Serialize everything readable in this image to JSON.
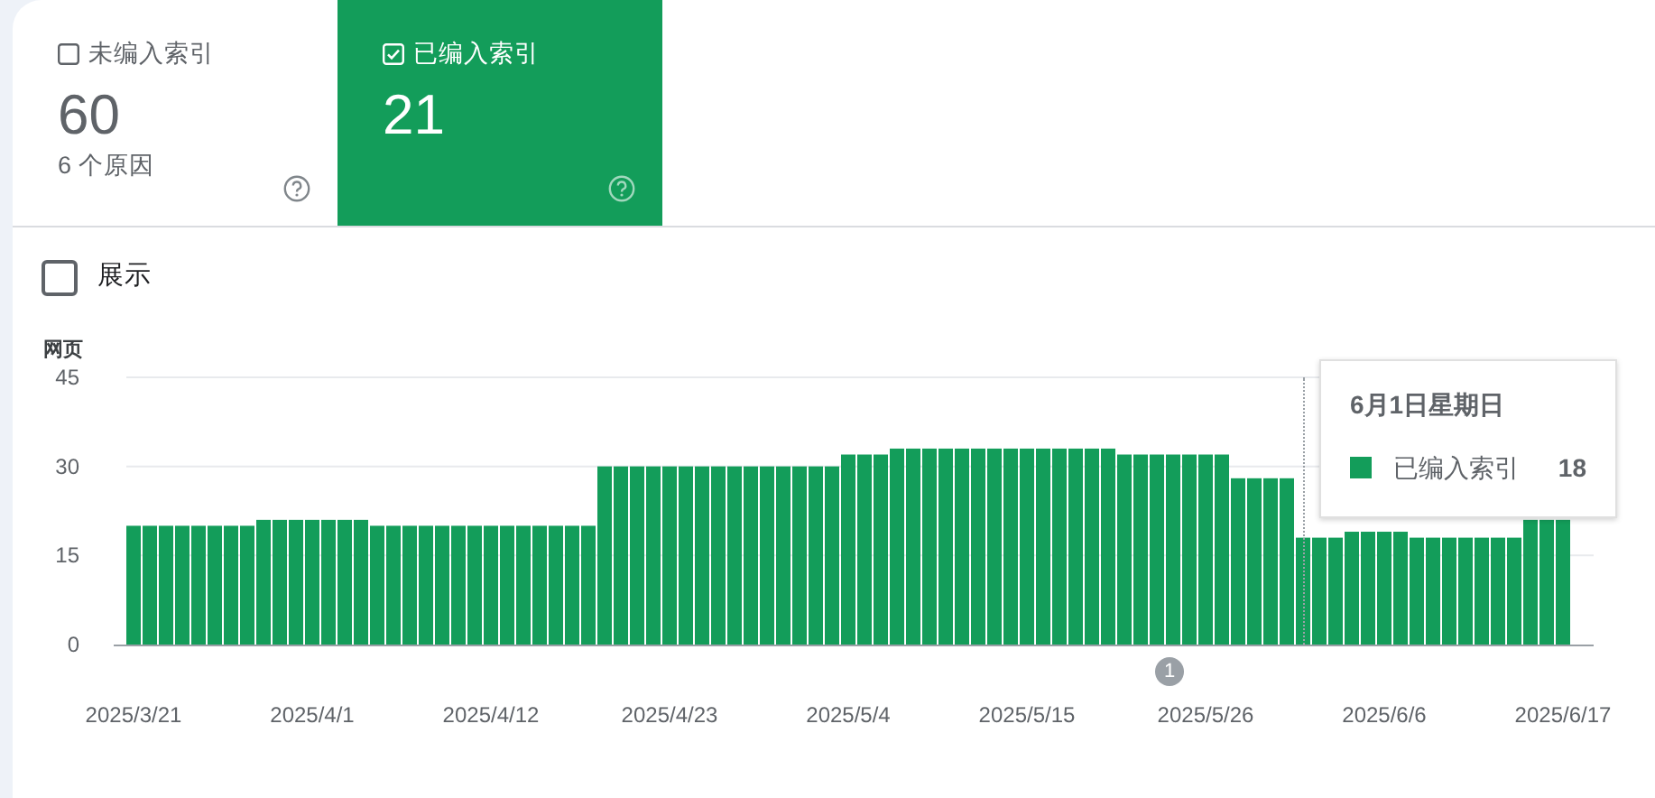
{
  "tabs": [
    {
      "label": "未编入索引",
      "count": "60",
      "subtitle": "6 个原因",
      "selected": false
    },
    {
      "label": "已编入索引",
      "count": "21",
      "selected": true
    }
  ],
  "show_toggle": {
    "label": "展示",
    "checked": false
  },
  "chart_data": {
    "type": "bar",
    "ylabel": "网页",
    "categories": [
      "2025/3/21",
      null,
      null,
      null,
      null,
      null,
      null,
      null,
      null,
      null,
      null,
      "2025/4/1",
      null,
      null,
      null,
      null,
      null,
      null,
      null,
      null,
      null,
      null,
      "2025/4/12",
      null,
      null,
      null,
      null,
      null,
      null,
      null,
      null,
      null,
      null,
      "2025/4/23",
      null,
      null,
      null,
      null,
      null,
      null,
      null,
      null,
      null,
      null,
      "2025/5/4",
      null,
      null,
      null,
      null,
      null,
      null,
      null,
      null,
      null,
      null,
      "2025/5/15",
      null,
      null,
      null,
      null,
      null,
      null,
      null,
      null,
      null,
      null,
      "2025/5/26",
      null,
      null,
      null,
      null,
      null,
      null,
      null,
      null,
      null,
      null,
      "2025/6/6",
      null,
      null,
      null,
      null,
      null,
      null,
      null,
      null,
      null,
      null,
      "2025/6/17"
    ],
    "series": [
      {
        "name": "已编入索引",
        "color": "#139d5a",
        "values": [
          20,
          20,
          20,
          20,
          20,
          20,
          20,
          20,
          21,
          21,
          21,
          21,
          21,
          21,
          21,
          20,
          20,
          20,
          20,
          20,
          20,
          20,
          20,
          20,
          20,
          20,
          20,
          20,
          20,
          30,
          30,
          30,
          30,
          30,
          30,
          30,
          30,
          30,
          30,
          30,
          30,
          30,
          30,
          30,
          32,
          32,
          32,
          33,
          33,
          33,
          33,
          33,
          33,
          33,
          33,
          33,
          33,
          33,
          33,
          33,
          33,
          32,
          32,
          32,
          32,
          32,
          32,
          32,
          28,
          28,
          28,
          28,
          18,
          18,
          18,
          19,
          19,
          19,
          19,
          18,
          18,
          18,
          18,
          18,
          18,
          18,
          21,
          21,
          21
        ]
      }
    ],
    "ylim": [
      0,
      45
    ],
    "yticks": [
      0,
      15,
      30,
      45
    ]
  },
  "event_marker": {
    "label": "1"
  },
  "tooltip": {
    "title": "6月1日星期日",
    "value": "18"
  }
}
